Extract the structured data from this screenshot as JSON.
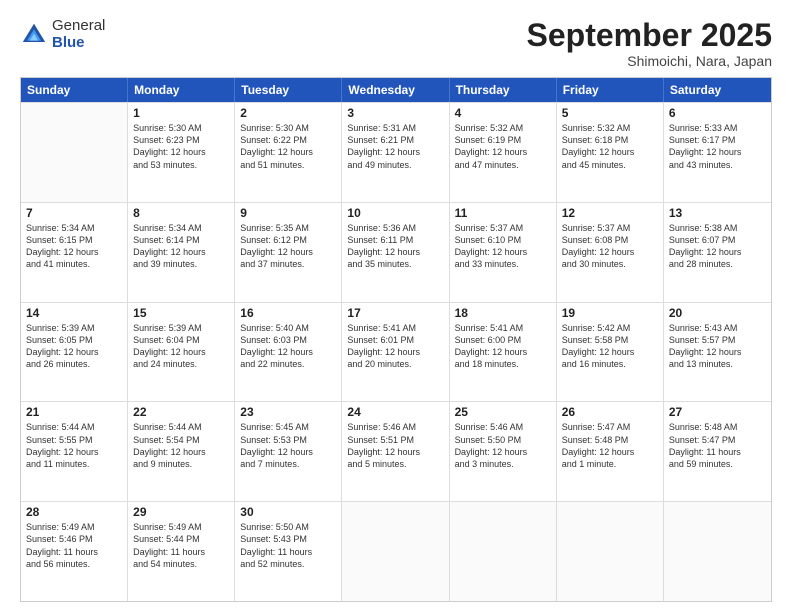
{
  "logo": {
    "general": "General",
    "blue": "Blue"
  },
  "title": "September 2025",
  "subtitle": "Shimoichi, Nara, Japan",
  "days": [
    "Sunday",
    "Monday",
    "Tuesday",
    "Wednesday",
    "Thursday",
    "Friday",
    "Saturday"
  ],
  "weeks": [
    [
      {
        "day": "",
        "info": ""
      },
      {
        "day": "1",
        "info": "Sunrise: 5:30 AM\nSunset: 6:23 PM\nDaylight: 12 hours\nand 53 minutes."
      },
      {
        "day": "2",
        "info": "Sunrise: 5:30 AM\nSunset: 6:22 PM\nDaylight: 12 hours\nand 51 minutes."
      },
      {
        "day": "3",
        "info": "Sunrise: 5:31 AM\nSunset: 6:21 PM\nDaylight: 12 hours\nand 49 minutes."
      },
      {
        "day": "4",
        "info": "Sunrise: 5:32 AM\nSunset: 6:19 PM\nDaylight: 12 hours\nand 47 minutes."
      },
      {
        "day": "5",
        "info": "Sunrise: 5:32 AM\nSunset: 6:18 PM\nDaylight: 12 hours\nand 45 minutes."
      },
      {
        "day": "6",
        "info": "Sunrise: 5:33 AM\nSunset: 6:17 PM\nDaylight: 12 hours\nand 43 minutes."
      }
    ],
    [
      {
        "day": "7",
        "info": "Sunrise: 5:34 AM\nSunset: 6:15 PM\nDaylight: 12 hours\nand 41 minutes."
      },
      {
        "day": "8",
        "info": "Sunrise: 5:34 AM\nSunset: 6:14 PM\nDaylight: 12 hours\nand 39 minutes."
      },
      {
        "day": "9",
        "info": "Sunrise: 5:35 AM\nSunset: 6:12 PM\nDaylight: 12 hours\nand 37 minutes."
      },
      {
        "day": "10",
        "info": "Sunrise: 5:36 AM\nSunset: 6:11 PM\nDaylight: 12 hours\nand 35 minutes."
      },
      {
        "day": "11",
        "info": "Sunrise: 5:37 AM\nSunset: 6:10 PM\nDaylight: 12 hours\nand 33 minutes."
      },
      {
        "day": "12",
        "info": "Sunrise: 5:37 AM\nSunset: 6:08 PM\nDaylight: 12 hours\nand 30 minutes."
      },
      {
        "day": "13",
        "info": "Sunrise: 5:38 AM\nSunset: 6:07 PM\nDaylight: 12 hours\nand 28 minutes."
      }
    ],
    [
      {
        "day": "14",
        "info": "Sunrise: 5:39 AM\nSunset: 6:05 PM\nDaylight: 12 hours\nand 26 minutes."
      },
      {
        "day": "15",
        "info": "Sunrise: 5:39 AM\nSunset: 6:04 PM\nDaylight: 12 hours\nand 24 minutes."
      },
      {
        "day": "16",
        "info": "Sunrise: 5:40 AM\nSunset: 6:03 PM\nDaylight: 12 hours\nand 22 minutes."
      },
      {
        "day": "17",
        "info": "Sunrise: 5:41 AM\nSunset: 6:01 PM\nDaylight: 12 hours\nand 20 minutes."
      },
      {
        "day": "18",
        "info": "Sunrise: 5:41 AM\nSunset: 6:00 PM\nDaylight: 12 hours\nand 18 minutes."
      },
      {
        "day": "19",
        "info": "Sunrise: 5:42 AM\nSunset: 5:58 PM\nDaylight: 12 hours\nand 16 minutes."
      },
      {
        "day": "20",
        "info": "Sunrise: 5:43 AM\nSunset: 5:57 PM\nDaylight: 12 hours\nand 13 minutes."
      }
    ],
    [
      {
        "day": "21",
        "info": "Sunrise: 5:44 AM\nSunset: 5:55 PM\nDaylight: 12 hours\nand 11 minutes."
      },
      {
        "day": "22",
        "info": "Sunrise: 5:44 AM\nSunset: 5:54 PM\nDaylight: 12 hours\nand 9 minutes."
      },
      {
        "day": "23",
        "info": "Sunrise: 5:45 AM\nSunset: 5:53 PM\nDaylight: 12 hours\nand 7 minutes."
      },
      {
        "day": "24",
        "info": "Sunrise: 5:46 AM\nSunset: 5:51 PM\nDaylight: 12 hours\nand 5 minutes."
      },
      {
        "day": "25",
        "info": "Sunrise: 5:46 AM\nSunset: 5:50 PM\nDaylight: 12 hours\nand 3 minutes."
      },
      {
        "day": "26",
        "info": "Sunrise: 5:47 AM\nSunset: 5:48 PM\nDaylight: 12 hours\nand 1 minute."
      },
      {
        "day": "27",
        "info": "Sunrise: 5:48 AM\nSunset: 5:47 PM\nDaylight: 11 hours\nand 59 minutes."
      }
    ],
    [
      {
        "day": "28",
        "info": "Sunrise: 5:49 AM\nSunset: 5:46 PM\nDaylight: 11 hours\nand 56 minutes."
      },
      {
        "day": "29",
        "info": "Sunrise: 5:49 AM\nSunset: 5:44 PM\nDaylight: 11 hours\nand 54 minutes."
      },
      {
        "day": "30",
        "info": "Sunrise: 5:50 AM\nSunset: 5:43 PM\nDaylight: 11 hours\nand 52 minutes."
      },
      {
        "day": "",
        "info": ""
      },
      {
        "day": "",
        "info": ""
      },
      {
        "day": "",
        "info": ""
      },
      {
        "day": "",
        "info": ""
      }
    ]
  ]
}
